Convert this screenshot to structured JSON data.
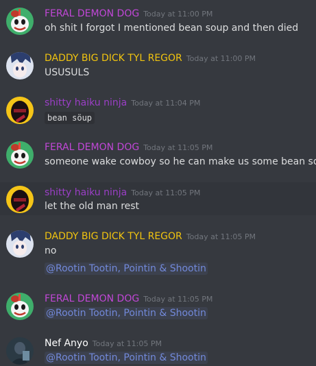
{
  "colors": {
    "feral": "#c147d7",
    "daddy": "#f1c40f",
    "ninja": "#9b3fc6",
    "nef": "#ffffff",
    "mention": "#7289da"
  },
  "messages": [
    {
      "author": "FERAL DEMON DOG",
      "time": "Today at 11:00 PM",
      "content": "oh shit I forgot I mentioned bean soup and then died"
    },
    {
      "author": "DADDY BIG DICK TYL REGOR",
      "time": "Today at 11:00 PM",
      "content": "USUSULS"
    },
    {
      "author": "shitty haiku ninja",
      "time": "Today at 11:04 PM",
      "code": "bean söup"
    },
    {
      "author": "FERAL DEMON DOG",
      "time": "Today at 11:05 PM",
      "content": "someone wake cowboy so he can make us some bean soup"
    },
    {
      "author": "shitty haiku ninja",
      "time": "Today at 11:05 PM",
      "content": "let the old man rest"
    },
    {
      "author": "DADDY BIG DICK TYL REGOR",
      "time": "Today at 11:05 PM",
      "content": "no",
      "mention": "@Rootin Tootin, Pointin & Shootin"
    },
    {
      "author": "FERAL DEMON DOG",
      "time": "Today at 11:05 PM",
      "mention": "@Rootin Tootin, Pointin & Shootin"
    },
    {
      "author": "Nef Anyo",
      "time": "Today at 11:05 PM",
      "mention": "@Rootin Tootin, Pointin & Shootin"
    }
  ]
}
